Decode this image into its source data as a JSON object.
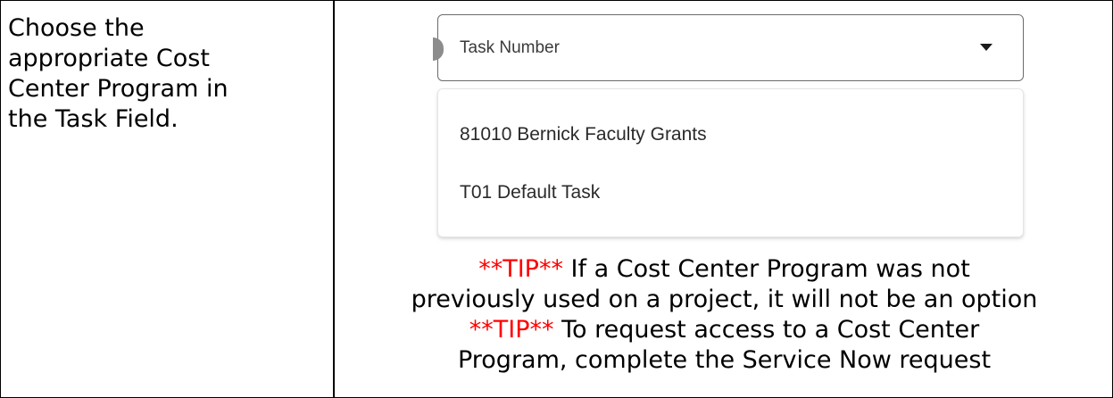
{
  "instruction": {
    "line1": "Choose the",
    "line2": "appropriate Cost",
    "line3": "Center Program in",
    "line4": "the Task Field."
  },
  "task_field": {
    "label": "Task Number",
    "icon": "caret-down-icon"
  },
  "dropdown": {
    "options": [
      "81010 Bernick Faculty Grants",
      "T01 Default Task"
    ]
  },
  "tips": {
    "tip1_flag": "**TIP**",
    "tip1_line1": " If a Cost Center Program was not",
    "tip1_line2": "previously used on a project, it will not be an option",
    "tip2_flag": "**TIP**",
    "tip2_line1": " To request access to a Cost Center",
    "tip2_line2": "Program, complete the Service Now request"
  },
  "colors": {
    "tip_flag": "#ff0000",
    "border": "#000000"
  }
}
